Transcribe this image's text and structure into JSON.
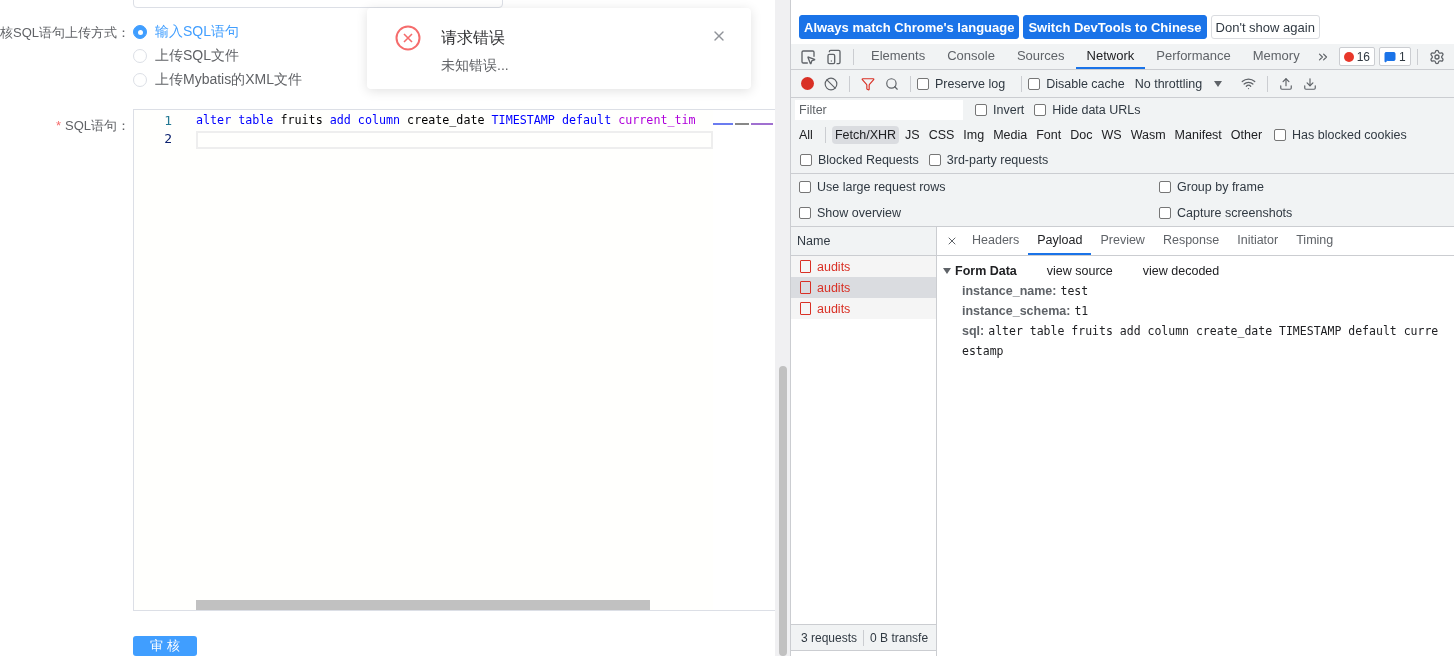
{
  "form": {
    "upload_label": "核SQL语句上传方式：",
    "upload_options": [
      {
        "label": "输入SQL语句",
        "selected": true
      },
      {
        "label": "上传SQL文件",
        "selected": false
      },
      {
        "label": "上传Mybatis的XML文件",
        "selected": false
      }
    ],
    "sql_label": "SQL语句：",
    "required_mark": "*",
    "editor_lines": [
      {
        "number": "1",
        "tokens": [
          {
            "text": "alter table",
            "kind": "keyword"
          },
          {
            "text": " fruits ",
            "kind": "plain"
          },
          {
            "text": "add column",
            "kind": "keyword"
          },
          {
            "text": " create_date ",
            "kind": "plain"
          },
          {
            "text": "TIMESTAMP default",
            "kind": "keyword"
          },
          {
            "text": " current_tim",
            "kind": "function"
          }
        ]
      },
      {
        "number": "2"
      }
    ],
    "submit_button": "审 核"
  },
  "toast": {
    "kind": "error",
    "title": "请求错误",
    "message": "未知错误..."
  },
  "devtools": {
    "banner_buttons": [
      {
        "label": "Always match Chrome's language",
        "kind": "primary"
      },
      {
        "label": "Switch DevTools to Chinese",
        "kind": "primary"
      },
      {
        "label": "Don't show again",
        "kind": "secondary"
      }
    ],
    "tabs": [
      {
        "label": "Elements",
        "selected": false
      },
      {
        "label": "Console",
        "selected": false
      },
      {
        "label": "Sources",
        "selected": false
      },
      {
        "label": "Network",
        "selected": true
      },
      {
        "label": "Performance",
        "selected": false
      },
      {
        "label": "Memory",
        "selected": false
      }
    ],
    "error_count": "16",
    "message_count": "1",
    "preserve_log": {
      "label": "Preserve log",
      "checked": false
    },
    "disable_cache": {
      "label": "Disable cache",
      "checked": false
    },
    "throttling": "No throttling",
    "filter": {
      "placeholder": "Filter"
    },
    "filter_options": [
      {
        "label": "Invert",
        "checked": false
      },
      {
        "label": "Hide data URLs",
        "checked": false
      }
    ],
    "types": [
      {
        "label": "All",
        "selected": false
      },
      {
        "label": "Fetch/XHR",
        "selected": true
      },
      {
        "label": "JS",
        "selected": false
      },
      {
        "label": "CSS",
        "selected": false
      },
      {
        "label": "Img",
        "selected": false
      },
      {
        "label": "Media",
        "selected": false
      },
      {
        "label": "Font",
        "selected": false
      },
      {
        "label": "Doc",
        "selected": false
      },
      {
        "label": "WS",
        "selected": false
      },
      {
        "label": "Wasm",
        "selected": false
      },
      {
        "label": "Manifest",
        "selected": false
      },
      {
        "label": "Other",
        "selected": false
      }
    ],
    "has_blocked_cookies": {
      "label": "Has blocked cookies",
      "checked": false
    },
    "request_filters": [
      {
        "label": "Blocked Requests",
        "checked": false
      },
      {
        "label": "3rd-party requests",
        "checked": false
      }
    ],
    "settings": [
      {
        "label": "Use large request rows",
        "checked": false
      },
      {
        "label": "Group by frame",
        "checked": false
      },
      {
        "label": "Show overview",
        "checked": false
      },
      {
        "label": "Capture screenshots",
        "checked": false
      }
    ],
    "name_header": "Name",
    "requests": [
      {
        "name": "audits",
        "selected": false
      },
      {
        "name": "audits",
        "selected": true
      },
      {
        "name": "audits",
        "selected": false
      }
    ],
    "detail_tabs": [
      {
        "label": "Headers",
        "selected": false
      },
      {
        "label": "Payload",
        "selected": true
      },
      {
        "label": "Preview",
        "selected": false
      },
      {
        "label": "Response",
        "selected": false
      },
      {
        "label": "Initiator",
        "selected": false
      },
      {
        "label": "Timing",
        "selected": false
      }
    ],
    "form_data": {
      "title": "Form Data",
      "expanded": true,
      "links": [
        "view source",
        "view decoded"
      ],
      "fields": [
        {
          "key": "instance_name:",
          "value_lines": [
            "test"
          ]
        },
        {
          "key": "instance_schema:",
          "value_lines": [
            "t1"
          ]
        },
        {
          "key": "sql:",
          "value_lines": [
            "alter table fruits add column create_date TIMESTAMP default curre",
            "estamp"
          ]
        }
      ]
    },
    "status": [
      "3 requests",
      "0 B transfe"
    ]
  }
}
